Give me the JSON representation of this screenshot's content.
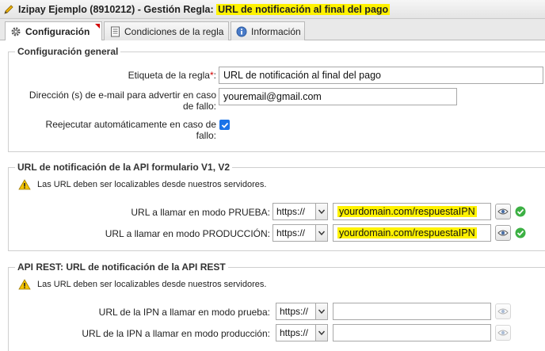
{
  "header": {
    "title_prefix": "Izipay Ejemplo (8910212) - Gestión Regla: ",
    "title_highlight": "URL de notificación al final del pago"
  },
  "tabs": [
    {
      "label": "Configuración",
      "icon": "gear-icon",
      "active": true
    },
    {
      "label": "Condiciones de la regla",
      "icon": "document-icon",
      "active": false
    },
    {
      "label": "Información",
      "icon": "info-icon",
      "active": false
    }
  ],
  "general": {
    "legend": "Configuración general",
    "rule_label": {
      "label": "Etiqueta de la regla",
      "required_mark": "*",
      "colon": ":",
      "value": "URL de notificación al final del pago"
    },
    "email": {
      "label_line1": "Dirección (s) de e-mail para advertir en caso",
      "label_line2": "de fallo:",
      "value": "youremail@gmail.com"
    },
    "retry": {
      "label_line1": "Reejecutar automáticamente en caso de",
      "label_line2": "fallo:",
      "checked": true
    }
  },
  "api_v1": {
    "legend": "URL de notificación de la API formulario V1, V2",
    "warning": "Las URL deben ser localizables desde nuestros servidores.",
    "test": {
      "label": "URL a llamar en modo PRUEBA:",
      "protocol": "https://",
      "value": "yourdomain.com/respuestaIPN"
    },
    "prod": {
      "label": "URL a llamar en modo PRODUCCIÓN:",
      "protocol": "https://",
      "value": "yourdomain.com/respuestaIPN"
    }
  },
  "api_rest": {
    "legend": "API REST: URL de notificación de la API REST",
    "warning": "Las URL deben ser localizables desde nuestros servidores.",
    "test": {
      "label": "URL de la IPN a llamar en modo prueba:",
      "protocol": "https://",
      "value": ""
    },
    "prod": {
      "label": "URL de la IPN a llamar en modo producción:",
      "protocol": "https://",
      "value": ""
    }
  },
  "colors": {
    "highlight": "#fff200",
    "required": "#d10000",
    "ok_green": "#3cb043",
    "checkbox": "#1a73e8"
  }
}
